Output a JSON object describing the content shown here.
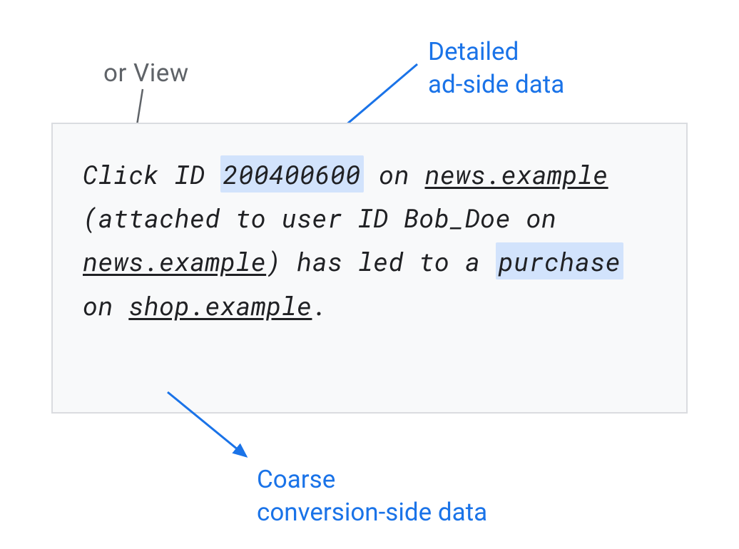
{
  "annotations": {
    "top_left": "or View",
    "top_right_line1": "Detailed",
    "top_right_line2": "ad-side data",
    "bottom_line1": "Coarse",
    "bottom_line2": "conversion-side data"
  },
  "main_text": {
    "part1": "Click ID ",
    "click_id": "200400600",
    "part2": " on ",
    "site1": "news.example",
    "part3": " (attached to user ID Bob_Doe on ",
    "site1_repeat": "news.example",
    "part4": ") has led to a ",
    "purchase": "purchase",
    "part5": " on ",
    "site2": "shop.example",
    "part6": "."
  }
}
